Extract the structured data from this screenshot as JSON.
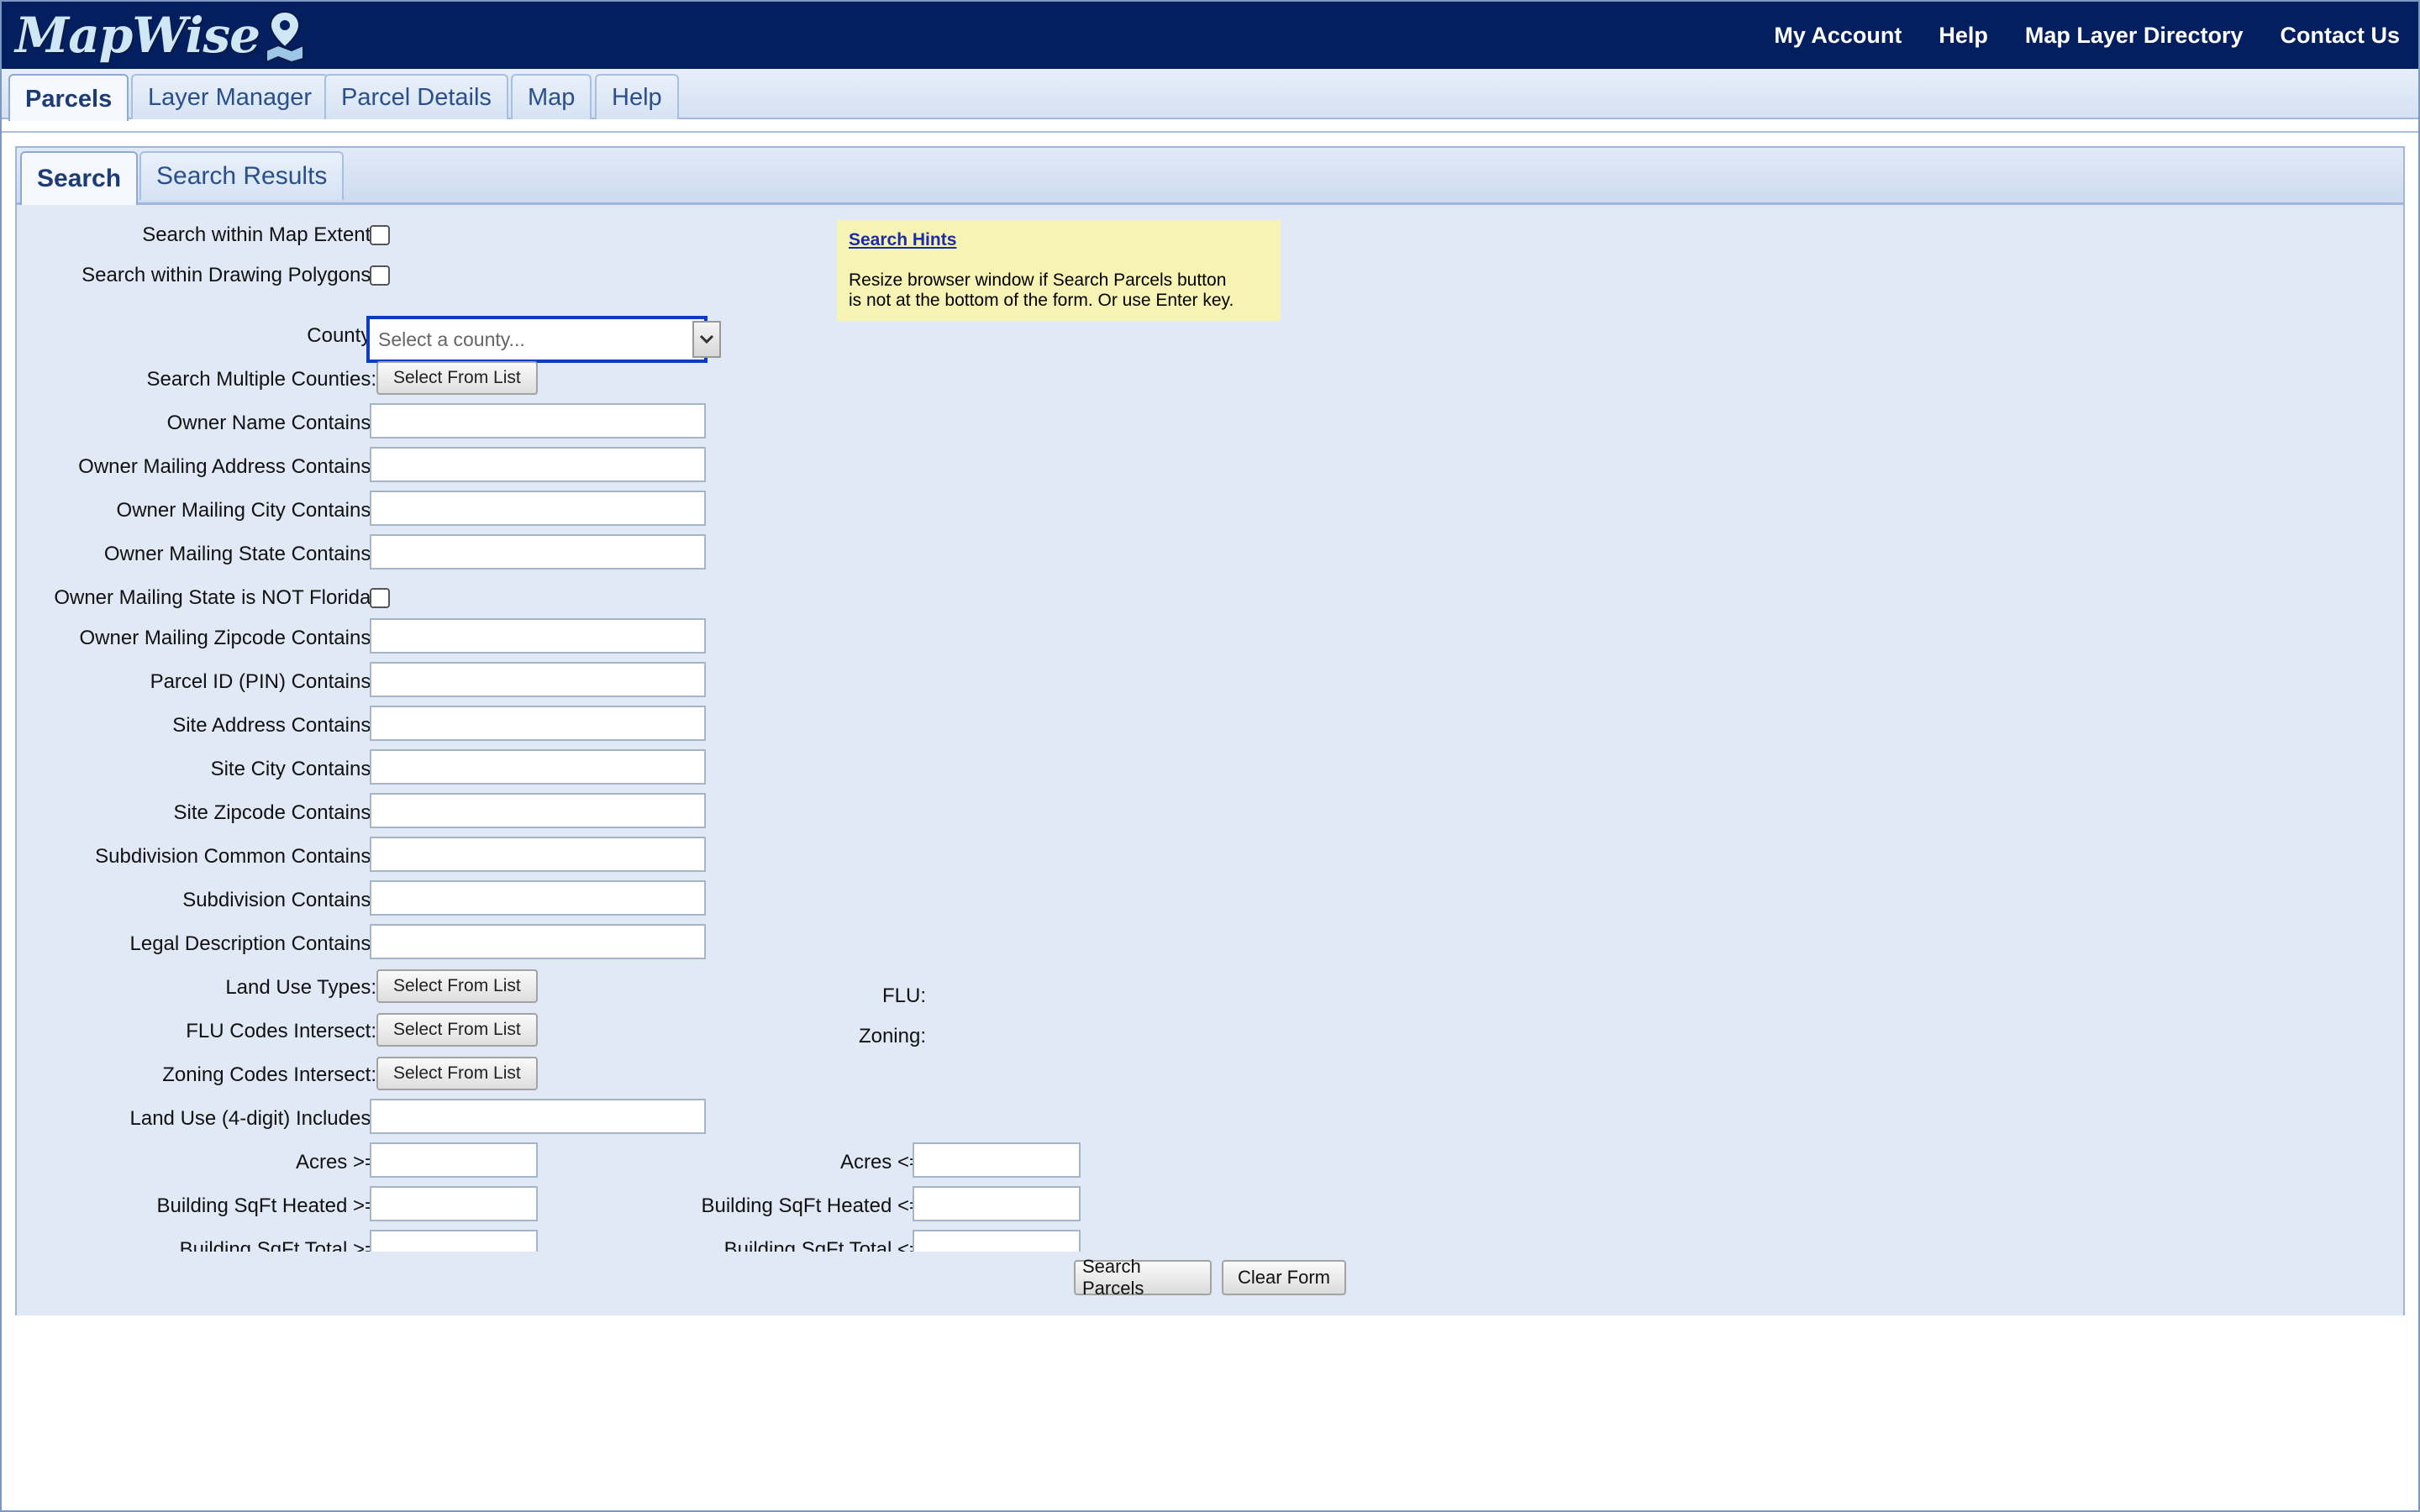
{
  "header": {
    "logo_text": "MapWise",
    "nav": [
      "My Account",
      "Help",
      "Map Layer Directory",
      "Contact Us"
    ]
  },
  "main_tabs": [
    "Parcels",
    "Layer Manager",
    "Parcel Details",
    "Map",
    "Help"
  ],
  "sub_tabs": [
    "Search",
    "Search Results"
  ],
  "form": {
    "map_extent_label": "Search within Map Extent:",
    "drawing_polygons_label": "Search within Drawing Polygons:",
    "county_label": "County:",
    "county_placeholder": "Select a county...",
    "multi_counties_label": "Search Multiple Counties:",
    "select_from_list": "Select From List",
    "owner_name_label": "Owner Name Contains:",
    "owner_address_label": "Owner Mailing Address Contains:",
    "owner_city_label": "Owner Mailing City Contains:",
    "owner_state_label": "Owner Mailing State Contains:",
    "not_florida_label": "Owner Mailing State is NOT Florida:",
    "owner_zip_label": "Owner Mailing Zipcode Contains:",
    "parcel_id_label": "Parcel ID (PIN) Contains:",
    "site_address_label": "Site Address Contains:",
    "site_city_label": "Site City Contains:",
    "site_zip_label": "Site Zipcode Contains:",
    "subdivision_common_label": "Subdivision Common Contains:",
    "subdivision_label": "Subdivision Contains:",
    "legal_description_label": "Legal Description Contains:",
    "land_use_types_label": "Land Use Types:",
    "flu_codes_label": "FLU Codes Intersect:",
    "zoning_codes_label": "Zoning Codes Intersect:",
    "land_use_4digit_label": "Land Use (4-digit) Includes:",
    "acres_min_label": "Acres >=",
    "acres_max_label": "Acres <=",
    "sqft_heated_min_label": "Building SqFt Heated >=",
    "sqft_heated_max_label": "Building SqFt Heated <=",
    "sqft_total_min_label": "Building SqFt Total >=",
    "sqft_total_max_label": "Building SqFt Total <=",
    "flu_label": "FLU:",
    "zoning_label": "Zoning:"
  },
  "hints": {
    "title": "Search Hints",
    "line1": "Resize browser window if Search Parcels button",
    "line2": "is not at the bottom of the form. Or use Enter key."
  },
  "buttons": {
    "search": "Search Parcels",
    "clear": "Clear Form"
  },
  "colors": {
    "header_bg": "#041f5f",
    "panel_bg": "#e1e9f6",
    "hints_bg": "#f6f3b4",
    "focus_border": "#0b3cc1"
  }
}
